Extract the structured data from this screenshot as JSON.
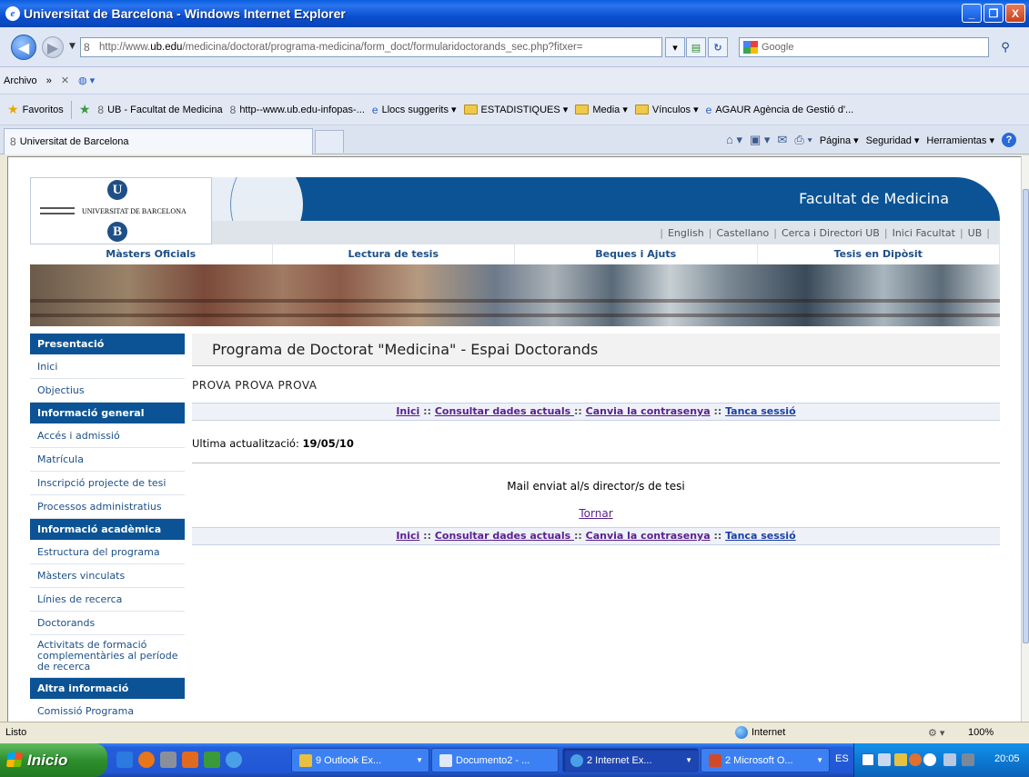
{
  "window": {
    "title": "Universitat de Barcelona - Windows Internet Explorer",
    "minimize": "_",
    "maximize": "❐",
    "close": "X"
  },
  "address": {
    "url_prefix": "http://www.",
    "url_host": "ub.edu",
    "url_rest": "/medicina/doctorat/programa-medicina/form_doct/formularidoctorands_sec.php?fitxer=",
    "search_placeholder": "Google"
  },
  "menubar": {
    "archivo": "Archivo",
    "more": "»"
  },
  "favorites": {
    "label": "Favoritos",
    "items": [
      {
        "label": "UB - Facultat de Medicina",
        "icon": "ub-icon"
      },
      {
        "label": "http--www.ub.edu-infopas-...",
        "icon": "ub-icon"
      },
      {
        "label": "Llocs suggerits ▾",
        "icon": "ie-icon"
      },
      {
        "label": "ESTADISTIQUES ▾",
        "icon": "folder-icon"
      },
      {
        "label": "Media ▾",
        "icon": "folder-icon"
      },
      {
        "label": "Vínculos ▾",
        "icon": "folder-icon"
      },
      {
        "label": "AGAUR Agència de Gestió d'...",
        "icon": "ie-icon"
      }
    ]
  },
  "tab": {
    "title": "Universitat de Barcelona"
  },
  "commandbar": {
    "pagina": "Página ▾",
    "seguridad": "Seguridad ▾",
    "herramientas": "Herramientas ▾"
  },
  "site": {
    "logo_text": "UNIVERSITAT DE BARCELONA",
    "logo_u": "U",
    "logo_b": "B",
    "faculty": "Facultat de Medicina",
    "top_links": [
      "English",
      "Castellano",
      "Cerca i Directori UB",
      "Inici Facultat",
      "UB"
    ],
    "main_menu": [
      "Màsters Oficials",
      "Lectura de tesis",
      "Beques i Ajuts",
      "Tesis en Dipòsit"
    ]
  },
  "sidebar": {
    "sections": [
      {
        "heading": "Presentació",
        "items": [
          "Inici",
          "Objectius"
        ]
      },
      {
        "heading": "Informació general",
        "items": [
          "Accés i admissió",
          "Matrícula",
          "Inscripció projecte de tesi",
          "Processos administratius"
        ]
      },
      {
        "heading": "Informació acadèmica",
        "items": [
          "Estructura del programa",
          "Màsters vinculats",
          "Línies de recerca",
          "Doctorands",
          "Activitats de formació complementàries al període de recerca"
        ]
      },
      {
        "heading": "Altra informació",
        "items": [
          "Comissió Programa"
        ]
      }
    ]
  },
  "main": {
    "heading": "Programa de Doctorat \"Medicina\" - Espai Doctorands",
    "user_name": "PROVA PROVA PROVA",
    "links": {
      "inici": "Inici",
      "consultar": "Consultar dades actuals ",
      "canvia": "Canvia la contrasenya",
      "tanca": "Tanca sessió",
      "sep": " :: "
    },
    "last_update_label": "Ultima actualització: ",
    "last_update_value": "19/05/10",
    "message": "Mail enviat al/s director/s de tesi",
    "back_link": "Tornar"
  },
  "statusbar": {
    "status": "Listo",
    "zone": "Internet",
    "zoom": "100%"
  },
  "taskbar": {
    "start": "Inicio",
    "tasks": [
      "9 Outlook Ex...",
      "Documento2 - ...",
      "2 Internet Ex...",
      "2 Microsoft O..."
    ],
    "lang": "ES",
    "clock": "20:05"
  }
}
